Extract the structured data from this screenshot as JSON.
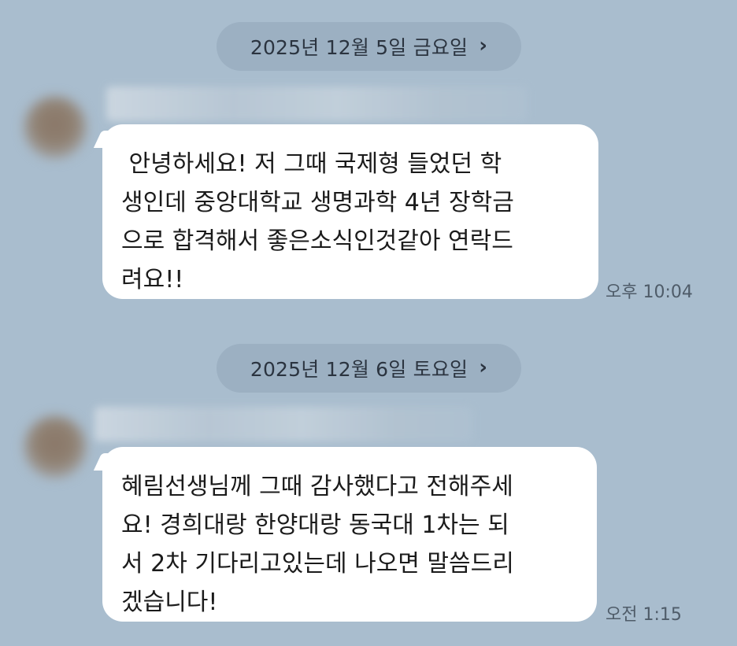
{
  "messages": [
    {
      "date_label": "2025년 12월 5일 금요일",
      "lines": [
        " 안녕하세요! 저 그때 국제형 들었던 학",
        "생인데 중앙대학교 생명과학 4년 장학금",
        "으로 합격해서 좋은소식인것같아 연락드",
        "려요!!"
      ],
      "time": "오후 10:04"
    },
    {
      "date_label": "2025년 12월 6일 토요일",
      "lines": [
        "혜림선생님께 그때 감사했다고 전해주세",
        "요! 경희대랑 한양대랑 동국대 1차는 되",
        "서 2차 기다리고있는데 나오면 말씀드리",
        "겠습니다!"
      ],
      "time": "오전 1:15"
    }
  ],
  "icons": {
    "date_chevron": "chevron-right-icon",
    "chevron_glyph": "›"
  },
  "colors": {
    "background": "#a9bdce",
    "date_pill": "#9cb0c2",
    "bubble": "#ffffff"
  }
}
